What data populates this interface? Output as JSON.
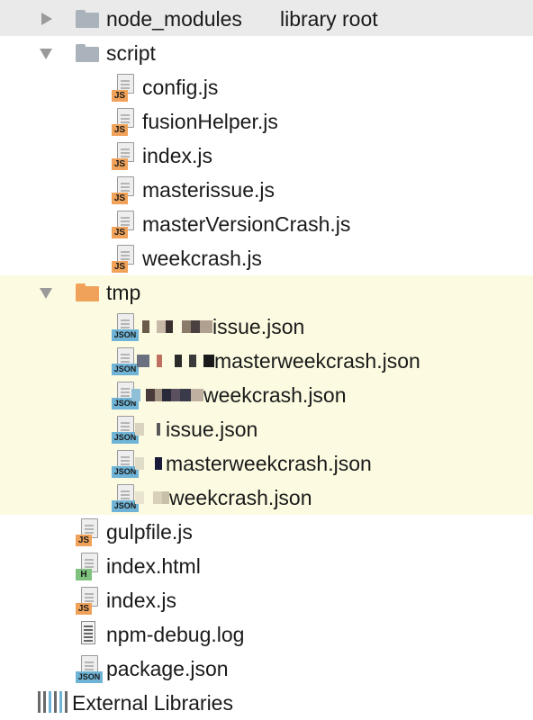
{
  "tree": {
    "root": {
      "name": "node_modules",
      "suffix": "library root"
    },
    "script": {
      "name": "script",
      "files": [
        {
          "name": "config.js",
          "badge": "JS"
        },
        {
          "name": "fusionHelper.js",
          "badge": "JS"
        },
        {
          "name": "index.js",
          "badge": "JS"
        },
        {
          "name": "masterissue.js",
          "badge": "JS"
        },
        {
          "name": "masterVersionCrash.js",
          "badge": "JS"
        },
        {
          "name": "weekcrash.js",
          "badge": "JS"
        }
      ]
    },
    "tmp": {
      "name": "tmp",
      "files": [
        {
          "name": "issue.json",
          "badge": "JSON"
        },
        {
          "name": "masterweekcrash.json",
          "badge": "JSON"
        },
        {
          "name": "weekcrash.json",
          "badge": "JSON"
        },
        {
          "name": "issue.json",
          "badge": "JSON"
        },
        {
          "name": "masterweekcrash.json",
          "badge": "JSON"
        },
        {
          "name": "weekcrash.json",
          "badge": "JSON"
        }
      ]
    },
    "top_files": [
      {
        "name": "gulpfile.js",
        "badge": "JS"
      },
      {
        "name": "index.html",
        "badge": "H"
      },
      {
        "name": "index.js",
        "badge": "JS"
      },
      {
        "name": "npm-debug.log",
        "icon": "log-file-icon"
      },
      {
        "name": "package.json",
        "badge": "JSON"
      }
    ],
    "external": {
      "name": "External Libraries"
    }
  },
  "colors": {
    "selected_row": "#eaeaea",
    "tmp_highlight": "#fcfbe1",
    "folder_grey": "#aab2bb",
    "folder_orange": "#f0a25a",
    "badge_js": "#f0a25a",
    "badge_json": "#6fb4d6",
    "badge_html": "#7ec27e"
  }
}
